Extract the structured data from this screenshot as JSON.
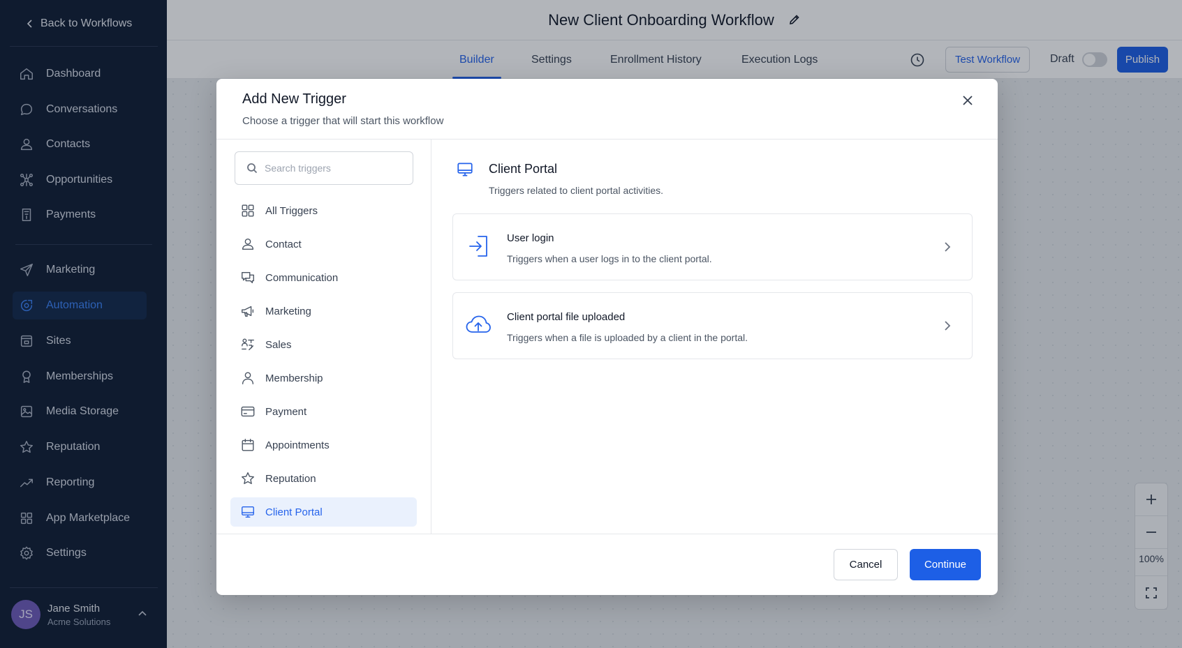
{
  "sidebar": {
    "back_label": "Back to Workflows",
    "items": [
      {
        "label": "Dashboard",
        "icon": "home-icon"
      },
      {
        "label": "Conversations",
        "icon": "chat-bubble-icon"
      },
      {
        "label": "Contacts",
        "icon": "person-icon"
      },
      {
        "label": "Opportunities",
        "icon": "network-icon"
      },
      {
        "label": "Payments",
        "icon": "receipt-icon"
      },
      {
        "label": "Marketing",
        "icon": "send-icon"
      },
      {
        "label": "Automation",
        "icon": "automation-icon",
        "active": true
      },
      {
        "label": "Sites",
        "icon": "browser-icon"
      },
      {
        "label": "Memberships",
        "icon": "badge-icon"
      },
      {
        "label": "Media Storage",
        "icon": "image-icon"
      },
      {
        "label": "Reputation",
        "icon": "star-icon"
      },
      {
        "label": "Reporting",
        "icon": "trend-icon"
      },
      {
        "label": "App Marketplace",
        "icon": "grid-icon"
      },
      {
        "label": "Settings",
        "icon": "gear-icon"
      }
    ],
    "user": {
      "initials": "JS",
      "name": "Jane Smith",
      "org": "Acme Solutions"
    }
  },
  "header": {
    "title": "New Client Onboarding Workflow",
    "tabs": [
      {
        "label": "Builder",
        "active": true
      },
      {
        "label": "Settings"
      },
      {
        "label": "Enrollment History"
      },
      {
        "label": "Execution Logs"
      }
    ],
    "test_label": "Test Workflow",
    "draft_label": "Draft",
    "publish_label": "Publish"
  },
  "zoom": {
    "level": "100%"
  },
  "modal": {
    "title": "Add New Trigger",
    "subtitle": "Choose a trigger that will start this workflow",
    "search_placeholder": "Search triggers",
    "categories": [
      {
        "label": "All Triggers",
        "icon": "grid-icon"
      },
      {
        "label": "Contact",
        "icon": "person-icon"
      },
      {
        "label": "Communication",
        "icon": "chat-icon"
      },
      {
        "label": "Marketing",
        "icon": "megaphone-icon"
      },
      {
        "label": "Sales",
        "icon": "sales-icon"
      },
      {
        "label": "Membership",
        "icon": "member-icon"
      },
      {
        "label": "Payment",
        "icon": "card-icon"
      },
      {
        "label": "Appointments",
        "icon": "calendar-icon"
      },
      {
        "label": "Reputation",
        "icon": "star-icon"
      },
      {
        "label": "Client Portal",
        "icon": "monitor-icon",
        "active": true
      }
    ],
    "section": {
      "title": "Client Portal",
      "subtitle": "Triggers related to client portal activities."
    },
    "triggers": [
      {
        "name": "User login",
        "desc": "Triggers when a user logs in to the client portal.",
        "icon": "login-icon"
      },
      {
        "name": "Client portal file uploaded",
        "desc": "Triggers when a file is uploaded by a client in the portal.",
        "icon": "cloud-upload-icon"
      }
    ],
    "cancel_label": "Cancel",
    "continue_label": "Continue"
  },
  "colors": {
    "sidebar_bg": "#101c33",
    "accent": "#2563eb",
    "primary_button": "#1d5fe6"
  }
}
